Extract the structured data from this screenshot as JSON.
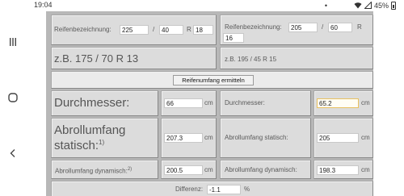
{
  "status": {
    "time": "19:04",
    "battery": "45%",
    "dots": "•"
  },
  "nav": {
    "recents": "recents-icon",
    "home": "home-icon",
    "back": "back-icon"
  },
  "left_tire": {
    "label": "Reifenbezeichnung:",
    "width": "225",
    "sep1": "/",
    "ratio": "40",
    "sep2": "R",
    "rim": "18",
    "example": "z.B. 175 / 70 R 13"
  },
  "right_tire": {
    "label": "Reifenbezeichnung:",
    "width": "205",
    "sep1": "/",
    "ratio": "60",
    "sep2": "R",
    "rim": "16",
    "example": "z.B. 195 / 45 R 15"
  },
  "calc_button": "Reifenumfang ermitteln",
  "rows": {
    "diameter": {
      "label": "Durchmesser:",
      "left_value": "66",
      "right_value": "65.2",
      "unit": "cm"
    },
    "static": {
      "label": "Abrollumfang statisch:",
      "left_label_line1": "Abrollumfang",
      "left_label_line2": "statisch:",
      "footnote": "1)",
      "left_value": "207.3",
      "right_value": "205",
      "unit": "cm"
    },
    "dynamic": {
      "label": "Abrollumfang dynamisch:",
      "footnote": "2)",
      "left_value": "200.5",
      "right_value": "198.3",
      "unit": "cm"
    }
  },
  "difference": {
    "label": "Differenz:",
    "value": "-1.1",
    "unit": "%"
  }
}
